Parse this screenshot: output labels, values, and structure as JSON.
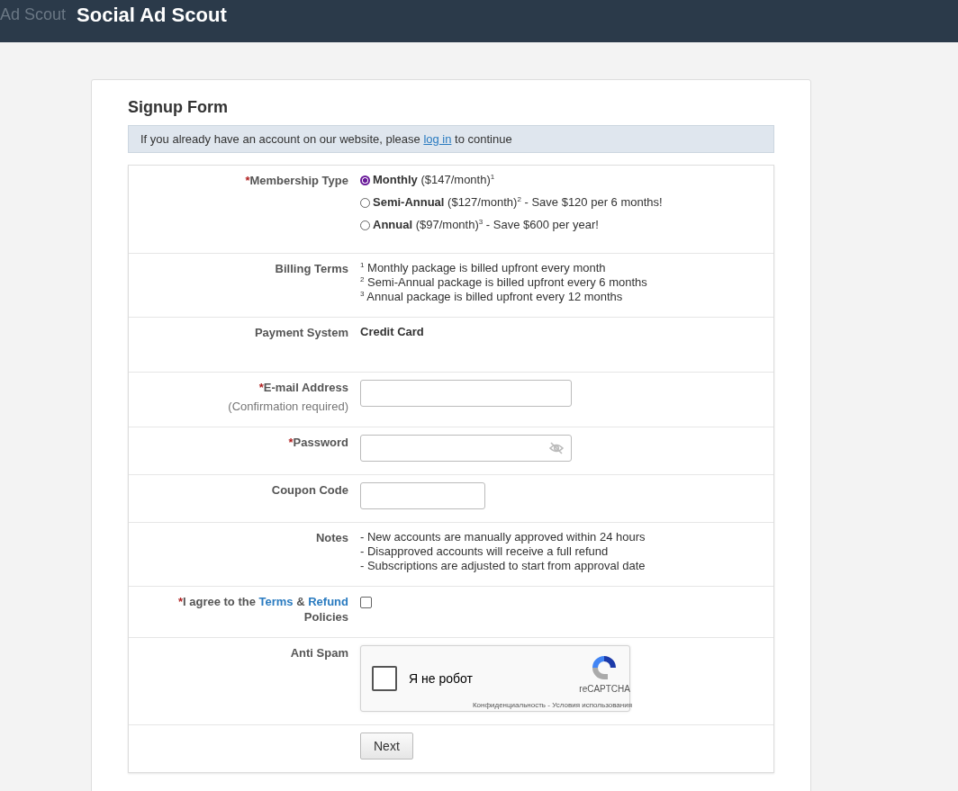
{
  "header": {
    "logo_text": "Ad Scout",
    "title": "Social Ad Scout"
  },
  "form": {
    "title": "Signup Form",
    "notice": {
      "before": "If you already have an account on our website, please ",
      "link": "log in",
      "after": " to continue"
    }
  },
  "rows": [
    {
      "kind": "radio",
      "label": "Membership Type",
      "required_mark": "*",
      "options": [
        {
          "name": "Monthly",
          "price": "($147/month)",
          "footnote": "1",
          "selected": true
        },
        {
          "name": "Semi-Annual",
          "price": "($127/month)",
          "footnote": "2",
          "extra": " - Save $120 per 6 months!",
          "selected": false
        },
        {
          "name": "Annual",
          "price": "($97/month)",
          "footnote": "3",
          "extra": " - Save $600 per year!",
          "selected": false
        }
      ]
    },
    {
      "kind": "footnotes",
      "label": "Billing Terms",
      "lines": [
        {
          "mark": "1",
          "text": "Monthly package is billed upfront every month"
        },
        {
          "mark": "2",
          "text": "Semi-Annual package is billed upfront every 6 months"
        },
        {
          "mark": "3",
          "text": "Annual package is billed upfront every 12 months"
        }
      ]
    },
    {
      "kind": "static",
      "label": "Payment System",
      "value": "Credit Card"
    },
    {
      "kind": "email",
      "label": "E-mail Address",
      "hint": "(Confirmation required)",
      "required_mark": "*"
    },
    {
      "kind": "password",
      "label": "Password",
      "required_mark": "*"
    },
    {
      "kind": "coupon",
      "label": "Coupon Code"
    },
    {
      "kind": "notes",
      "label": "Notes",
      "lines": [
        "- New accounts are manually approved within 24 hours",
        "- Disapproved accounts will receive a full refund",
        "- Subscriptions are adjusted to start from approval date"
      ]
    },
    {
      "kind": "agree",
      "required_mark": "*",
      "before": "I agree to the",
      "link1": "Terms",
      "amp": "&",
      "link2": "Refund",
      "after": "Policies",
      "checked": false
    },
    {
      "kind": "captcha",
      "label": "Anti Spam",
      "checked": false,
      "text": "Я не робот",
      "brand": "reCAPTCHA",
      "privacy": "Конфиденциальность",
      "sep": "-",
      "terms": "Условия использования"
    },
    {
      "kind": "button",
      "label": "Next"
    }
  ]
}
